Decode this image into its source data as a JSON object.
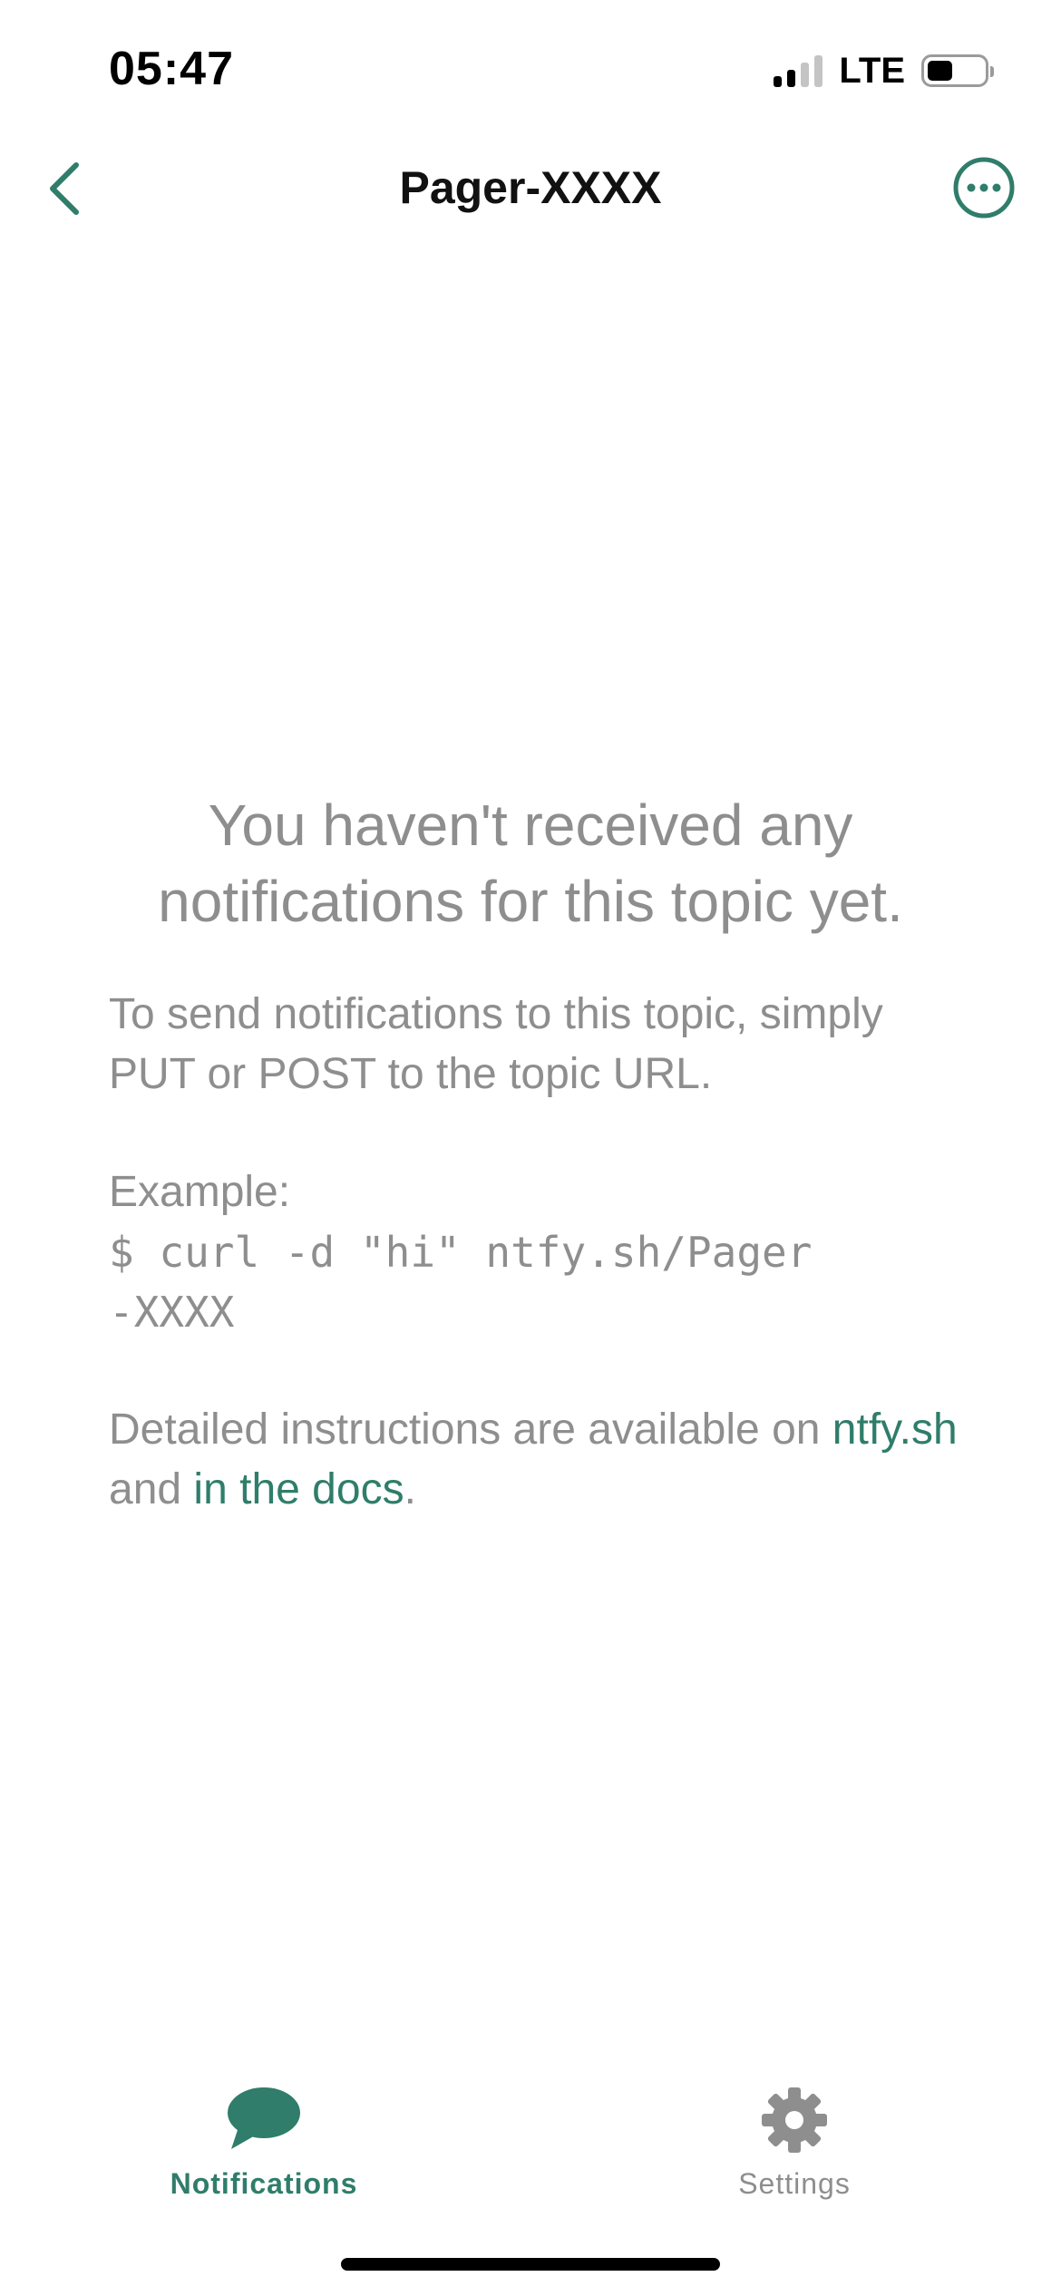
{
  "status_bar": {
    "time": "05:47",
    "network": "LTE",
    "signal_bars_active": 2,
    "signal_bars_total": 4,
    "battery_level": 0.45
  },
  "nav": {
    "title": "Pager-XXXX",
    "back_icon": "chevron-left-icon",
    "more_icon": "ellipsis-circle-icon"
  },
  "empty_state": {
    "title": "You haven't received any notifications for this topic yet.",
    "instructions": "To send notifications to this topic, simply PUT or POST to the topic URL.",
    "example_label": "Example:",
    "example_command": "$ curl -d \"hi\" ntfy.sh/Pager-XXXX",
    "details_prefix": "Detailed instructions are available on ",
    "details_link1": "ntfy.sh",
    "details_middle": " and ",
    "details_link2": "in the docs",
    "details_suffix": "."
  },
  "tabs": [
    {
      "label": "Notifications",
      "icon": "chat-bubble-icon",
      "active": true
    },
    {
      "label": "Settings",
      "icon": "gear-icon",
      "active": false
    }
  ],
  "colors": {
    "accent": "#2f7d6a",
    "text_muted": "#8e8e8e",
    "tab_inactive": "#8e8e8e"
  }
}
